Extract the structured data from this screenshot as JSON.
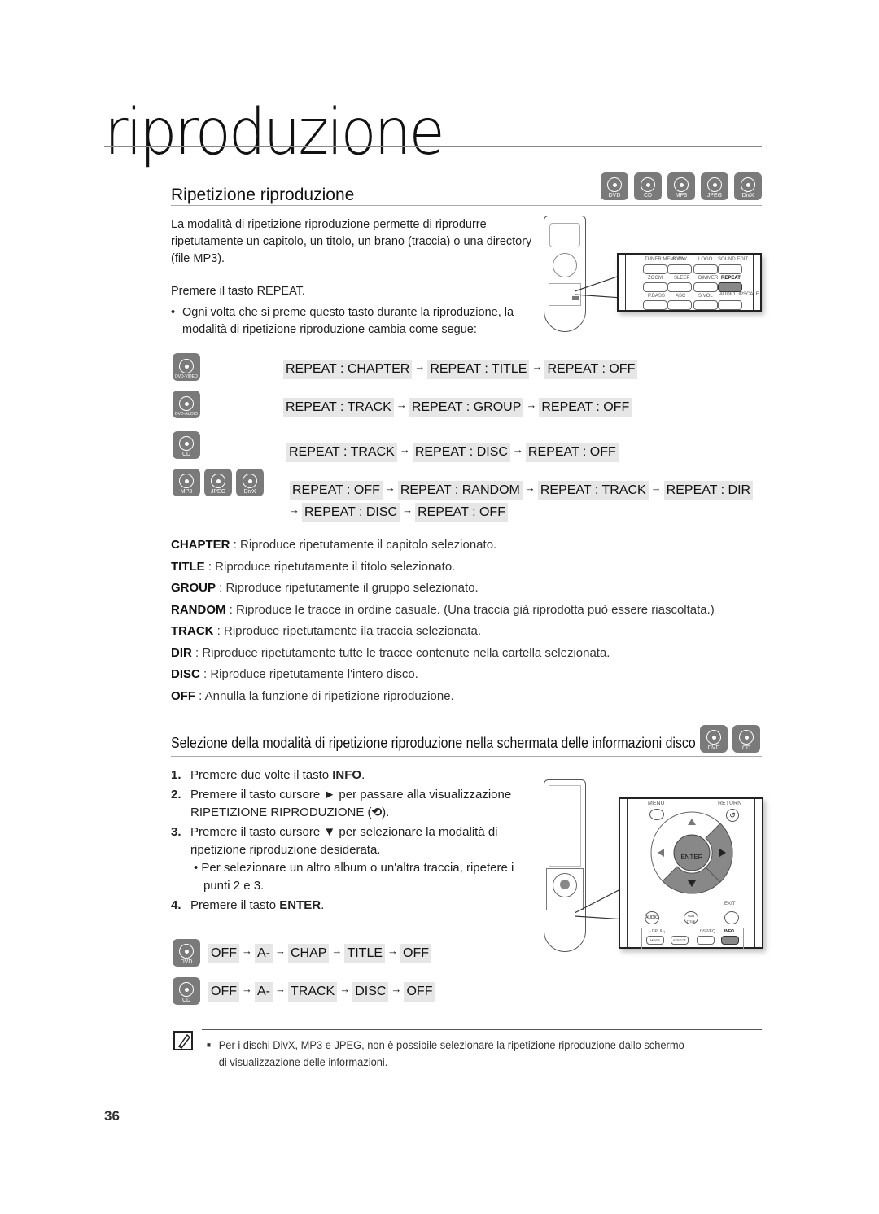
{
  "chapter": {
    "title": "riproduzione"
  },
  "section1": {
    "title": "Ripetizione riproduzione",
    "disc_icons": [
      "DVD",
      "CD",
      "MP3",
      "JPEG",
      "DivX"
    ],
    "intro": "La modalità di ripetizione riproduzione permette di riprodurre ripetutamente un capitolo, un titolo, un brano (traccia) o una directory (file MP3).",
    "press_prefix": "Premere il tasto ",
    "press_key": "REPEAT",
    "press_suffix": ".",
    "bullet": "Ogni volta che si preme questo tasto durante la riproduzione, la modalità di ripetizione riproduzione cambia come segue:",
    "remote_labels": {
      "row1": [
        "TUNER MEMORY",
        "SLOW",
        "LOGO",
        "SOUND EDIT"
      ],
      "row1_inner": [
        "SD/HD",
        "MO/ST",
        "",
        ""
      ],
      "row2": [
        "ZOOM",
        "SLEEP",
        "DIMMER",
        "REPEAT"
      ],
      "row3": [
        "P.BASS",
        "ASC",
        "S.VOL",
        "AUDIO UPSCALE"
      ]
    },
    "sequences": [
      {
        "icons": [
          "DVD-VIDEO"
        ],
        "steps": [
          "REPEAT : CHAPTER",
          "REPEAT : TITLE",
          "REPEAT : OFF"
        ]
      },
      {
        "icons": [
          "DVD-AUDIO"
        ],
        "steps": [
          "REPEAT : TRACK",
          "REPEAT : GROUP",
          "REPEAT : OFF"
        ]
      },
      {
        "icons": [
          "CD"
        ],
        "steps": [
          "REPEAT : TRACK",
          "REPEAT : DISC",
          "REPEAT : OFF"
        ]
      },
      {
        "icons": [
          "MP3",
          "JPEG",
          "DivX"
        ],
        "steps": [
          "REPEAT : OFF",
          "REPEAT : RANDOM",
          "REPEAT : TRACK",
          "REPEAT : DIR"
        ],
        "steps_line2": [
          "REPEAT : DISC",
          "REPEAT : OFF"
        ]
      }
    ],
    "arrow": "→",
    "definitions": [
      {
        "term": "CHAPTER",
        "text": " : Riproduce ripetutamente il capitolo selezionato."
      },
      {
        "term": "TITLE",
        "text": " : Riproduce ripetutamente il titolo selezionato."
      },
      {
        "term": "GROUP",
        "text": " : Riproduce ripetutamente il gruppo selezionato."
      },
      {
        "term": "RANDOM",
        "text": " : Riproduce le tracce in ordine casuale. (Una traccia già riprodotta può essere riascoltata.)"
      },
      {
        "term": "TRACK",
        "text": " : Riproduce ripetutamente ila traccia selezionata."
      },
      {
        "term": "DIR",
        "text": " : Riproduce ripetutamente tutte le tracce contenute nella cartella selezionata."
      },
      {
        "term": "DISC",
        "text": " : Riproduce ripetutamente l'intero disco."
      },
      {
        "term": "OFF",
        "text": " : Annulla la funzione di ripetizione riproduzione."
      }
    ]
  },
  "section2": {
    "title": "Selezione della modalità di ripetizione riproduzione nella schermata delle informazioni disco",
    "disc_icons": [
      "DVD",
      "CD"
    ],
    "steps": [
      {
        "num": "1.",
        "pre": "Premere due volte il tasto ",
        "key": "INFO",
        "post": "."
      },
      {
        "num": "2.",
        "pre": "Premere il tasto cursore ► per passare alla visualizzazione RIPETIZIONE RIPRODUZIONE (",
        "key": "⟲",
        "post": ")."
      },
      {
        "num": "3.",
        "pre": "Premere il tasto cursore ▼ per selezionare la modalità di ripetizione riproduzione desiderata.",
        "key": "",
        "post": ""
      },
      {
        "num": "4.",
        "pre": "Premere il tasto ",
        "key": "ENTER",
        "post": "."
      }
    ],
    "sub_bullet": "Per selezionare un altro album o un'altra traccia, ripetere i punti 2 e 3.",
    "remote_labels": {
      "menu": "MENU",
      "return": "RETURN",
      "enter": "ENTER",
      "exit": "EXIT",
      "audio": "AUDIO",
      "subtitle": "SUB TITLE",
      "pl2": "┌ DPLII ┐",
      "mode": "MODE",
      "effect": "EFFECT",
      "dspeq": "DSP/EQ",
      "info": "INFO"
    },
    "sequences": [
      {
        "icon": "DVD",
        "steps": [
          "OFF",
          "A-",
          "CHAP",
          "TITLE",
          "OFF"
        ]
      },
      {
        "icon": "CD",
        "steps": [
          "OFF",
          "A-",
          "TRACK",
          "DISC",
          "OFF"
        ]
      }
    ]
  },
  "note": {
    "text": "Per i dischi DivX, MP3 e JPEG, non è possibile selezionare la ripetizione riproduzione dallo schermo di visualizzazione delle informazioni."
  },
  "page_number": "36"
}
